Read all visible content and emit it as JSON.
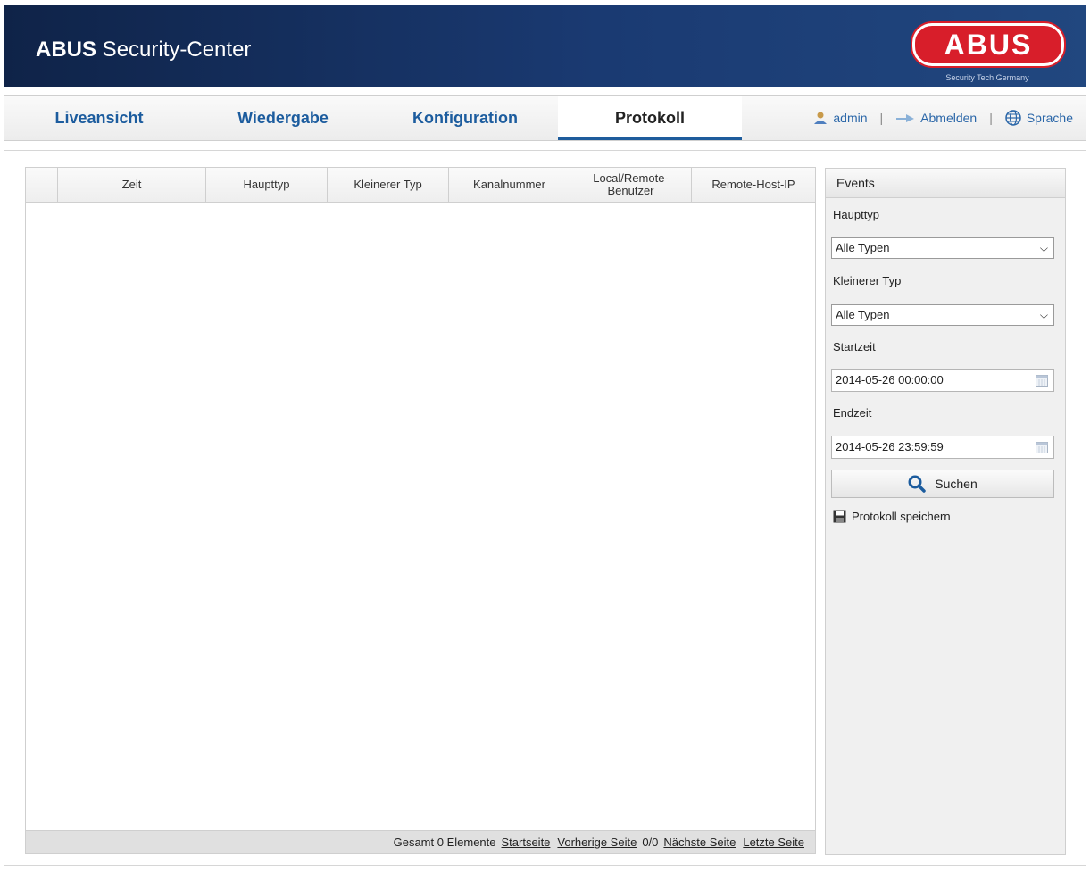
{
  "header": {
    "title_brand": "ABUS",
    "title_rest": " Security-Center",
    "logo_text": "ABUS",
    "logo_sub": "Security Tech Germany"
  },
  "nav": {
    "tabs": [
      "Liveansicht",
      "Wiedergabe",
      "Konfiguration",
      "Protokoll"
    ],
    "active_tab": "Protokoll",
    "user": "admin",
    "logout": "Abmelden",
    "language": "Sprache"
  },
  "table": {
    "columns": [
      "",
      "Zeit",
      "Haupttyp",
      "Kleinerer Typ",
      "Kanalnummer",
      "Local/Remote-Benutzer",
      "Remote-Host-IP"
    ],
    "rows": []
  },
  "pagination": {
    "total": "Gesamt 0 Elemente",
    "first": "Startseite",
    "prev": "Vorherige Seite",
    "page": "0/0",
    "next": "Nächste Seite",
    "last": "Letzte Seite"
  },
  "side": {
    "heading": "Events",
    "main_type_label": "Haupttyp",
    "main_type_value": "Alle Typen",
    "sub_type_label": "Kleinerer Typ",
    "sub_type_value": "Alle Typen",
    "start_label": "Startzeit",
    "start_value": "2014-05-26 00:00:00",
    "end_label": "Endzeit",
    "end_value": "2014-05-26 23:59:59",
    "search_label": "Suchen",
    "save_label": "Protokoll speichern"
  },
  "colors": {
    "banner": "#1a3a72",
    "link": "#1c5c9e",
    "logo_red": "#d81e2a"
  }
}
